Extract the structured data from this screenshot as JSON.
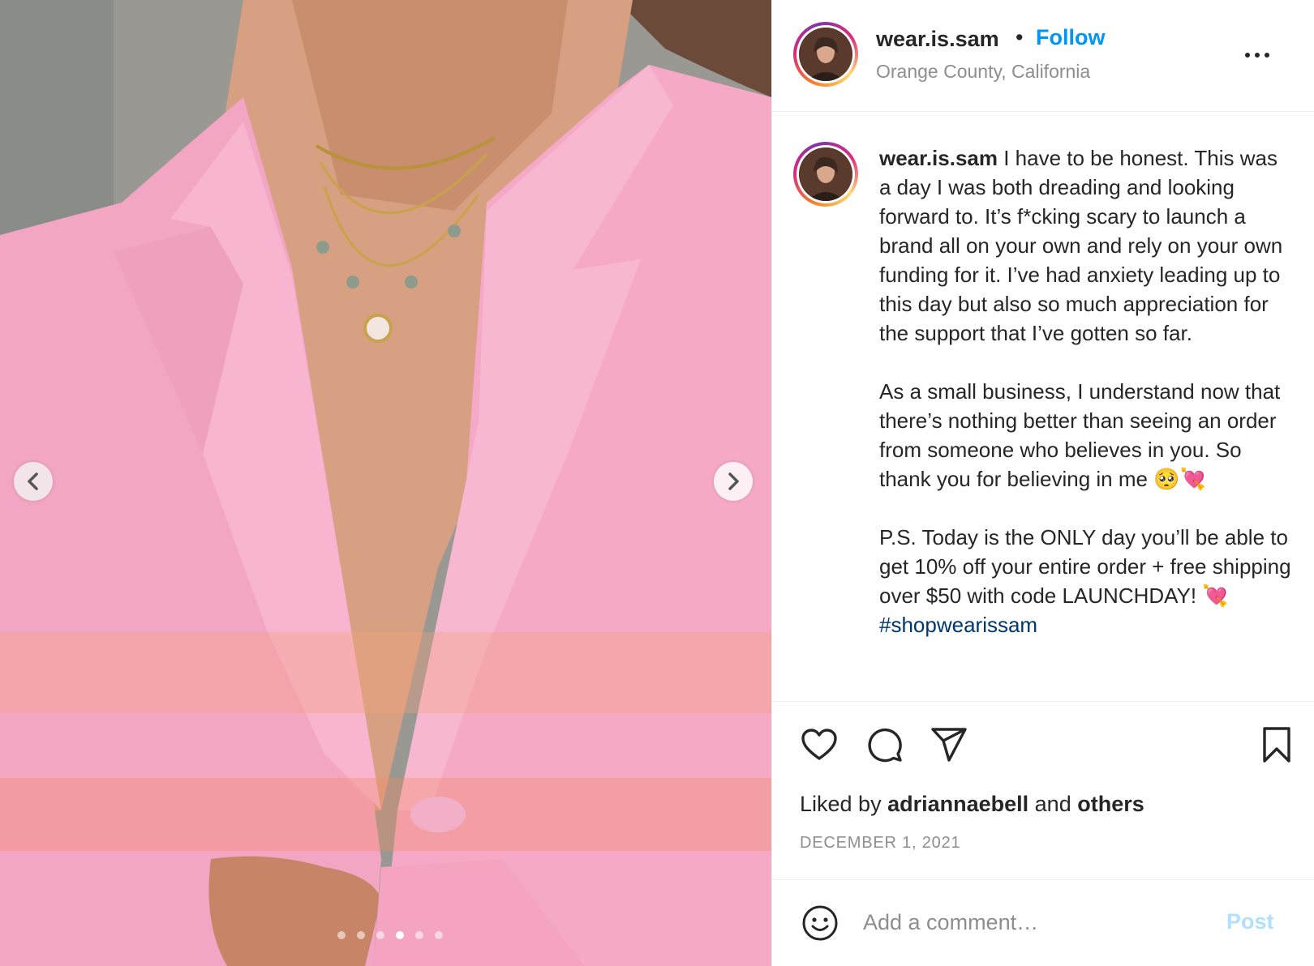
{
  "media": {
    "current_slide": 4,
    "total_slides": 6,
    "prev_icon": "chevron-left-icon",
    "next_icon": "chevron-right-icon"
  },
  "header": {
    "username": "wear.is.sam",
    "separator": "•",
    "follow_label": "Follow",
    "location": "Orange County, California",
    "more_icon": "more-horizontal-icon"
  },
  "caption": {
    "username": "wear.is.sam",
    "body": " I have to be honest. This was a day I was both dreading and looking forward to. It’s f*cking scary to launch a brand all on your own and rely on your own funding for it. I’ve had anxiety leading up to this day but also so much appreciation for the support that I’ve gotten so far.\n\nAs a small business, I understand now that there’s nothing better than seeing an order from someone who believes in you. So thank you for believing in me 🥺💘\n\nP.S. Today is the ONLY day you’ll be able to get 10% off your entire order + free shipping over $50 with code LAUNCHDAY! 💘 ",
    "hashtag": "#shopwearissam"
  },
  "actions": {
    "like_icon": "heart-icon",
    "comment_icon": "comment-icon",
    "share_icon": "paper-plane-icon",
    "save_icon": "bookmark-icon",
    "liked_by_prefix": "Liked by ",
    "liked_by_user": "adriannaebell",
    "liked_by_and": " and ",
    "liked_by_others": "others",
    "date": "DECEMBER 1, 2021"
  },
  "comment": {
    "emoji_icon": "smiley-icon",
    "placeholder": "Add a comment…",
    "post_label": "Post"
  },
  "colors": {
    "accent": "#0095f6",
    "post_disabled": "#b2dffc",
    "hashtag": "#00376b",
    "muted": "#8e8e8e"
  }
}
